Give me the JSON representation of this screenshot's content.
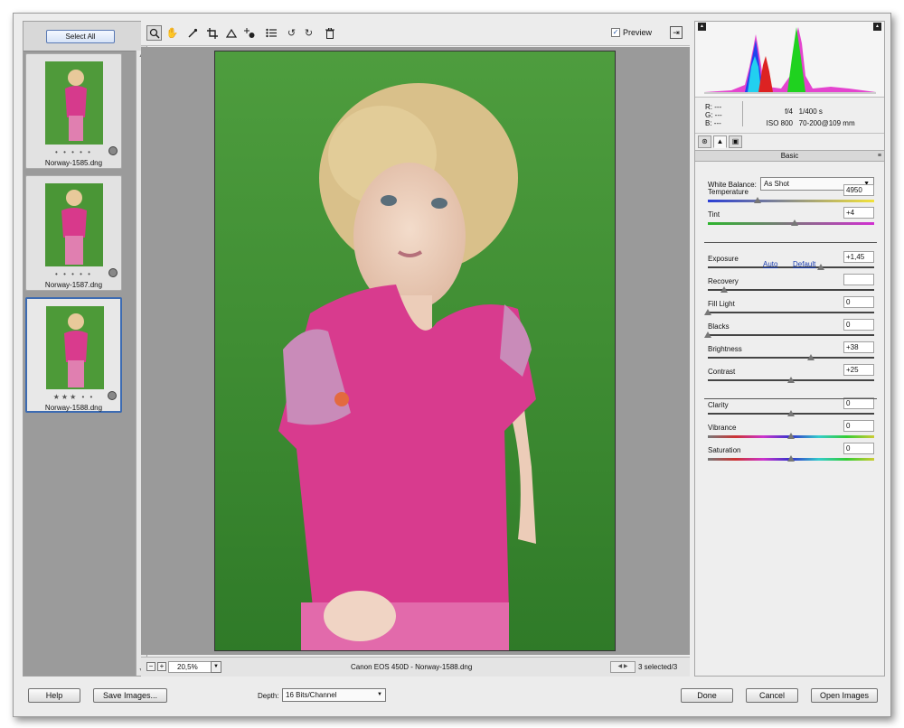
{
  "filmstrip": {
    "select_all": "Select All",
    "thumbnails": [
      {
        "filename": "Norway-1585.dng",
        "stars": "• • • • •",
        "selected": false
      },
      {
        "filename": "Norway-1587.dng",
        "stars": "• • • • •",
        "selected": false
      },
      {
        "filename": "Norway-1588.dng",
        "stars": "★★★ • •",
        "selected": true
      }
    ]
  },
  "toolbar": {
    "tools": [
      "zoom-icon",
      "hand-icon",
      "white-balance-icon",
      "crop-icon",
      "straighten-icon",
      "redeye-icon",
      "list-icon",
      "rotate-left-icon",
      "rotate-right-icon",
      "trash-icon"
    ],
    "preview_label": "Preview",
    "preview_checked": true
  },
  "statusbar": {
    "zoom": "20,5%",
    "camera_info": "Canon EOS 450D  -  Norway-1588.dng",
    "selected": "3 selected/3"
  },
  "info": {
    "r": "R:   ---",
    "g": "G:   ---",
    "b": "B:   ---",
    "aperture": "f/4",
    "shutter": "1/400 s",
    "iso": "ISO 800",
    "lens": "70-200@109 mm"
  },
  "basic": {
    "section_title": "Basic",
    "wb_label": "White Balance:",
    "wb_value": "As Shot",
    "auto": "Auto",
    "default": "Default",
    "adjustments": [
      {
        "label": "Temperature",
        "value": "4950",
        "position": 0.3
      },
      {
        "label": "Tint",
        "value": "+4",
        "position": 0.52
      },
      {
        "label": "Exposure",
        "value": "+1,45",
        "position": 0.68
      },
      {
        "label": "Recovery",
        "value": "",
        "position": 0.1
      },
      {
        "label": "Fill Light",
        "value": "0",
        "position": 0.0
      },
      {
        "label": "Blacks",
        "value": "0",
        "position": 0.0
      },
      {
        "label": "Brightness",
        "value": "+38",
        "position": 0.62
      },
      {
        "label": "Contrast",
        "value": "+25",
        "position": 0.5
      },
      {
        "label": "Clarity",
        "value": "0",
        "position": 0.5
      },
      {
        "label": "Vibrance",
        "value": "0",
        "position": 0.5
      },
      {
        "label": "Saturation",
        "value": "0",
        "position": 0.5
      }
    ]
  },
  "bottom": {
    "help": "Help",
    "save": "Save Images...",
    "depth_label": "Depth:",
    "depth_value": "16 Bits/Channel",
    "done": "Done",
    "cancel": "Cancel",
    "open": "Open Images"
  }
}
